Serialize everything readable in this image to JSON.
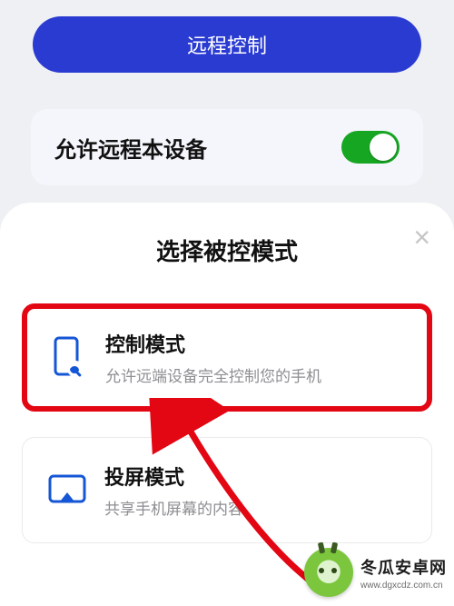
{
  "top": {
    "primary_button": "远程控制"
  },
  "allow_remote": {
    "label": "允许远程本设备",
    "on": true
  },
  "sheet": {
    "title": "选择被控模式",
    "options": [
      {
        "title": "控制模式",
        "desc": "允许远端设备完全控制您的手机",
        "icon": "phone-wrench",
        "highlighted": true
      },
      {
        "title": "投屏模式",
        "desc": "共享手机屏幕的内容",
        "icon": "cast-screen",
        "highlighted": false
      }
    ]
  },
  "watermark": {
    "line1": "冬瓜安卓网",
    "line2": "www.dgxcdz.com.cn"
  }
}
